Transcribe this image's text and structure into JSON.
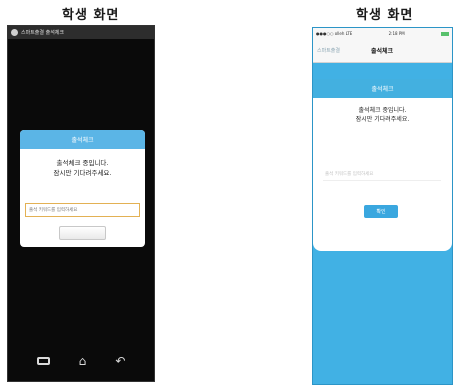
{
  "headings": {
    "left": "학생 화면",
    "right": "학생 화면"
  },
  "android": {
    "status_title": "스마트출결 출석체크",
    "dialog": {
      "title": "출석체크",
      "message_line1": "출석체크 중입니다.",
      "message_line2": "잠시만 기다려주세요.",
      "input_placeholder": "출석 키워드를 입력하세요",
      "button_label": ""
    },
    "nav_icons": [
      "recent-apps-icon",
      "home-icon",
      "back-icon"
    ]
  },
  "ios": {
    "status_left": "●●●○○ olleh LTE",
    "status_time": "2:18 PM",
    "back_label": "스마트출결",
    "nav_title": "출석체크",
    "dialog": {
      "title": "출석체크",
      "message_line1": "출석체크 중입니다.",
      "message_line2": "잠시만 기다려주세요.",
      "input_placeholder": "출석 키워드를 입력하세요",
      "button_label": "확인"
    }
  },
  "colors": {
    "accent": "#43b0e0",
    "ios_background": "#41b1e4",
    "android_input_border": "#e3b154"
  }
}
